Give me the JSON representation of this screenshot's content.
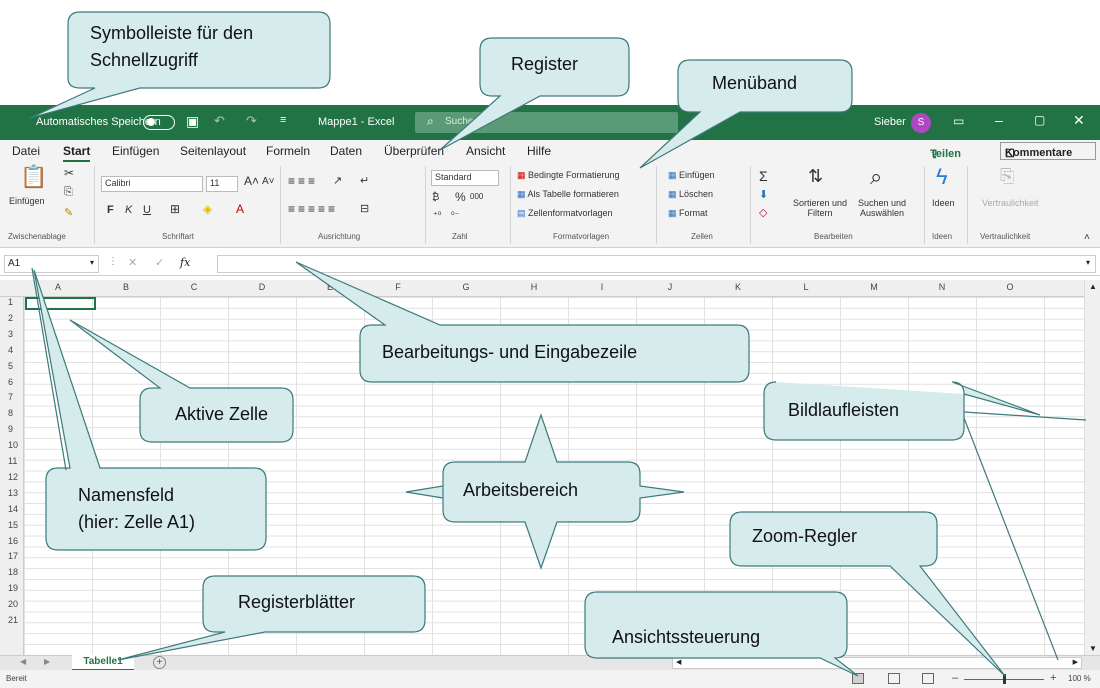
{
  "titlebar": {
    "autosave_label": "Automatisches Speichern",
    "doc_title": "Mappe1 - Excel",
    "search_placeholder": "Suchen",
    "user_name": "Sieber",
    "avatar_initial": "S"
  },
  "tabs": [
    "Datei",
    "Start",
    "Einfügen",
    "Seitenlayout",
    "Formeln",
    "Daten",
    "Überprüfen",
    "Ansicht",
    "Hilfe"
  ],
  "share_label": "Teilen",
  "comment_label": "Kommentare",
  "ribbon": {
    "clipboard": {
      "paste": "Einfügen",
      "group": "Zwischenablage"
    },
    "font": {
      "name": "Calibri",
      "size": "11",
      "bold": "F",
      "italic": "K",
      "underline": "U",
      "group": "Schriftart"
    },
    "alignment": {
      "group": "Ausrichtung"
    },
    "number": {
      "format": "Standard",
      "percent": "%",
      "thousands": "000",
      "group": "Zahl"
    },
    "styles": {
      "conditional": "Bedingte Formatierung",
      "table": "Als Tabelle formatieren",
      "cell": "Zellenformatvorlagen",
      "group": "Formatvorlagen"
    },
    "cells": {
      "insert": "Einfügen",
      "delete": "Löschen",
      "format": "Format",
      "group": "Zellen"
    },
    "editing": {
      "sort": "Sortieren und Filtern",
      "find": "Suchen und Auswählen",
      "group": "Bearbeiten"
    },
    "ideas": {
      "label": "Ideen",
      "group": "Ideen"
    },
    "sensitivity": {
      "label": "Vertraulichkeit",
      "group": "Vertraulichkeit"
    }
  },
  "namebox": "A1",
  "fx": "fx",
  "columns": [
    "A",
    "B",
    "C",
    "D",
    "E",
    "F",
    "G",
    "H",
    "I",
    "J",
    "K",
    "L",
    "M",
    "N",
    "O"
  ],
  "rows": [
    "1",
    "2",
    "3",
    "4",
    "5",
    "6",
    "7",
    "8",
    "9",
    "10",
    "11",
    "12",
    "13",
    "14",
    "15",
    "16",
    "17",
    "18",
    "19",
    "20",
    "21"
  ],
  "sheet_tab": "Tabelle1",
  "status": {
    "ready": "Bereit",
    "zoom": "100 %"
  },
  "callouts": {
    "qat": [
      "Symbolleiste für den",
      "Schnellzugriff"
    ],
    "register": "Register",
    "ribbon": "Menüband",
    "formula": "Bearbeitungs- und Eingabezeile",
    "active": "Aktive Zelle",
    "workarea": "Arbeitsbereich",
    "scrollbars": "Bildlaufleisten",
    "namebox": [
      "Namensfeld",
      "(hier: Zelle A1)"
    ],
    "zoom": "Zoom-Regler",
    "sheets": "Registerblätter",
    "views": "Ansichtssteuerung"
  },
  "colors": {
    "excel_green": "#217346",
    "callout_fill": "#d6ebec",
    "callout_stroke": "#3d7a7c"
  }
}
